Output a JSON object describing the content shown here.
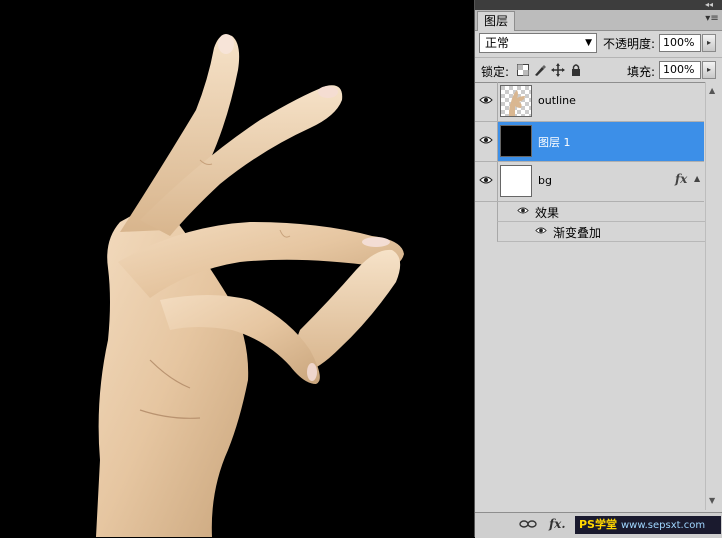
{
  "panel": {
    "tab_label": "图层",
    "panel_menu_glyph": "▾≡",
    "top_collapse_glyph": "◂◂"
  },
  "blend": {
    "mode": "正常",
    "opacity_label": "不透明度:",
    "opacity_value": "100%",
    "lock_label": "锁定:",
    "fill_label": "填充:",
    "fill_value": "100%"
  },
  "layers": [
    {
      "name": "outline",
      "visible": true,
      "selected": false,
      "thumb": "hand-thumbnail"
    },
    {
      "name": "图层 1",
      "visible": true,
      "selected": true,
      "thumb": "black-fill"
    },
    {
      "name": "bg",
      "visible": true,
      "selected": false,
      "thumb": "white-fill",
      "fx": "fx"
    }
  ],
  "effects": {
    "group_label": "效果",
    "items": [
      "渐变叠加"
    ]
  },
  "bottom_bar": {
    "link_icon": "link-icon",
    "fx_label": "fx.",
    "watermark_ps": "PS学堂",
    "watermark_site": "www.sepsxt.com"
  },
  "colors": {
    "panel_bg": "#d6d6d6",
    "selection": "#3c8fe8",
    "canvas_bg": "#000000"
  }
}
